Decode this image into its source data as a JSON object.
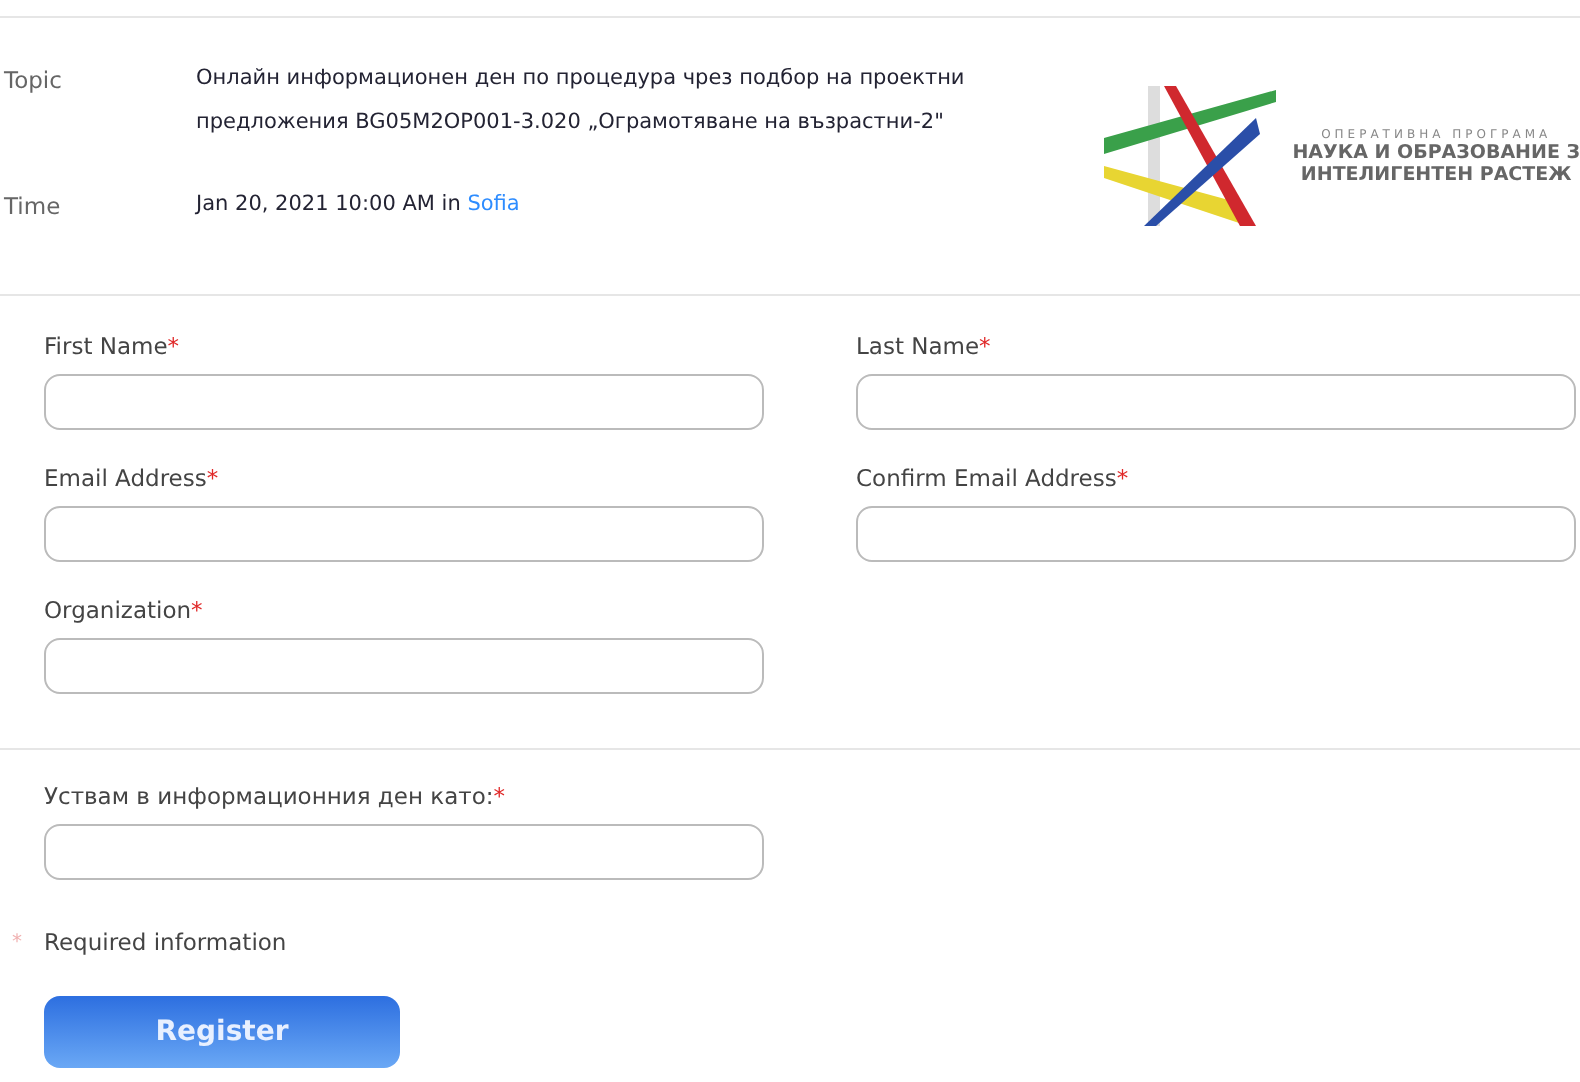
{
  "meeting": {
    "rows": [
      {
        "label": "Topic",
        "value": "Онлайн информационен ден по процедура чрез подбор на проектни предложения BG05M2OP001-3.020 „Ограмотяване на възрастни-2\""
      },
      {
        "label": "Time",
        "value": "Jan 20, 2021 10:00 AM in",
        "link": "Sofia"
      }
    ],
    "logo": {
      "lines": [
        "ОПЕРАТИВНА ПРОГРАМА",
        "НАУКА И ОБРАЗОВАНИЕ З",
        "ИНТЕЛИГЕНТЕН РАСТЕЖ"
      ]
    }
  },
  "form": {
    "required_mark": "*",
    "rows": [
      [
        {
          "label": "First Name",
          "required": true
        },
        {
          "label": "Last Name",
          "required": true
        }
      ],
      [
        {
          "label": "Email Address",
          "required": true
        },
        {
          "label": "Confirm Email Address",
          "required": true
        }
      ],
      [
        {
          "label": "Organization",
          "required": true
        }
      ]
    ],
    "extra_fields": [
      {
        "label": "Уствам в информационния ден като:",
        "required": true
      }
    ],
    "required_note": "Required information",
    "submit": "Register"
  }
}
